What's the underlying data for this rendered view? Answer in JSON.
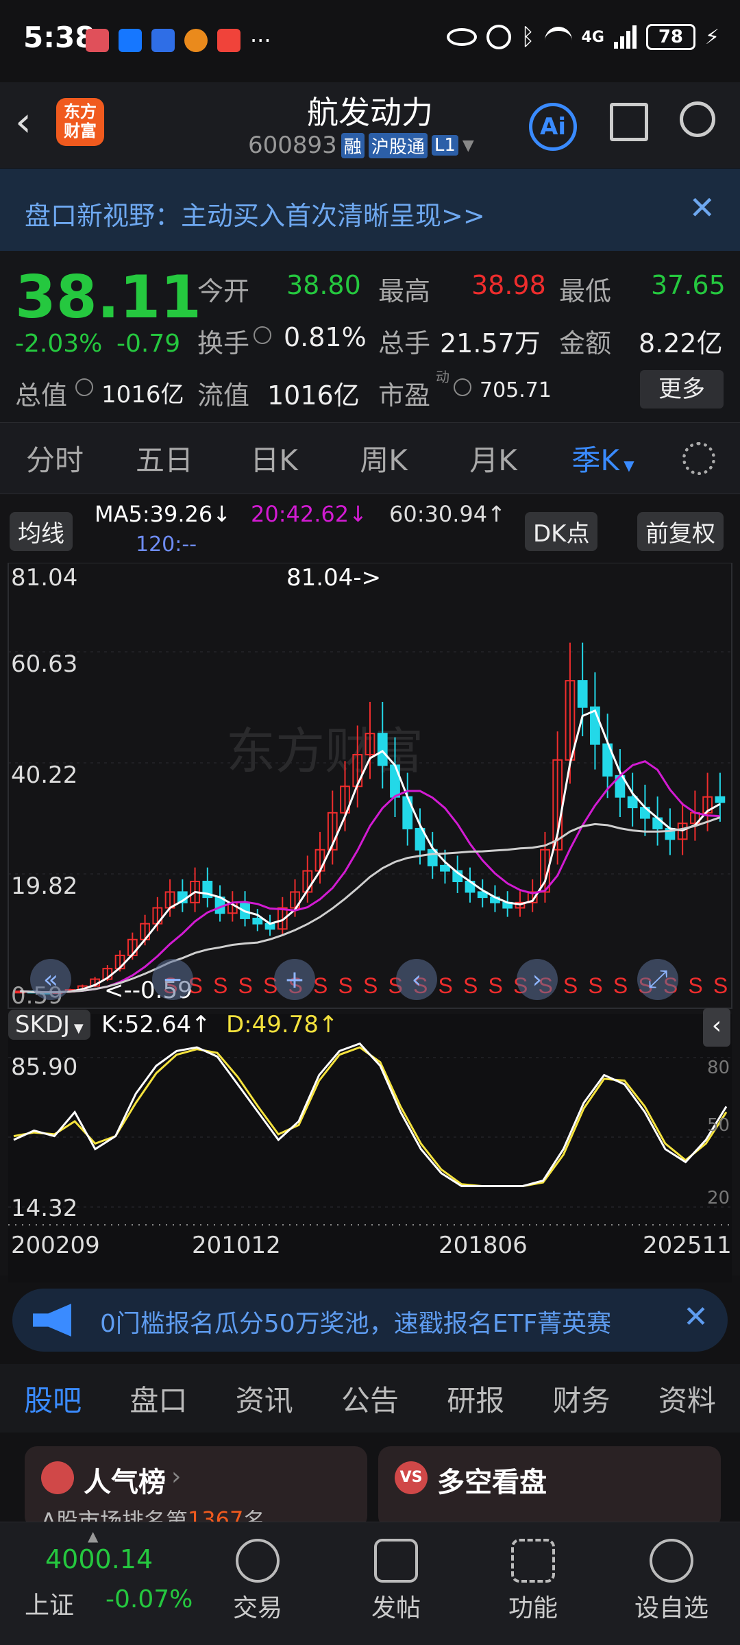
{
  "status": {
    "time": "5:38",
    "ellipsis": "···",
    "signal": "4G",
    "battery": "78"
  },
  "header": {
    "title": "航发动力",
    "code": "600893",
    "tag_rong": "融",
    "tag_hgt": "沪股通",
    "tag_l1": "L1",
    "logo_line1": "东方",
    "logo_line2": "财富",
    "ai_label": "Ai"
  },
  "banner": {
    "text": "盘口新视野：主动买入首次清晰呈现>>",
    "close": "✕"
  },
  "quote": {
    "price": "38.11",
    "change_pct": "-2.03%",
    "change_amt": "-0.79",
    "open_label": "今开",
    "open": "38.80",
    "high_label": "最高",
    "high": "38.98",
    "low_label": "最低",
    "low": "37.65",
    "turnover_label": "换手",
    "turnover": "0.81%",
    "volume_label": "总手",
    "volume": "21.57万",
    "amount_label": "金额",
    "amount": "8.22亿",
    "mcap_label": "总值",
    "mcap": "1016亿",
    "float_label": "流值",
    "float": "1016亿",
    "pe_label": "市盈",
    "pe_sup": "动",
    "pe": "705.71",
    "more": "更多"
  },
  "ktabs": [
    "分时",
    "五日",
    "日K",
    "周K",
    "月K",
    "季K"
  ],
  "chart_header": {
    "ma_btn": "均线",
    "ma5": "MA5:39.26↓",
    "ma20": "20:42.62↓",
    "ma60": "60:30.94↑",
    "ma120": "120:--",
    "dk_btn": "DK点",
    "fq_btn": "前复权"
  },
  "chart_data": {
    "type": "candlestick",
    "y_ticks": [
      "81.04",
      "60.63",
      "40.22",
      "19.82",
      "0.59"
    ],
    "ylim": [
      0.59,
      81.04
    ],
    "high_note": "81.04->",
    "low_note": "<--0.59",
    "x_ticks": [
      "200209",
      "201012",
      "201806",
      "202511"
    ],
    "signal": "S",
    "closes": [
      1.2,
      1.0,
      0.9,
      1.1,
      1.5,
      2.2,
      3.5,
      5.5,
      8,
      11,
      14,
      17,
      20,
      18,
      22,
      19,
      16,
      18,
      15,
      14,
      13,
      17,
      20,
      24,
      28,
      35,
      40,
      46,
      50,
      44,
      38,
      32,
      28,
      25,
      24,
      22,
      20,
      19,
      18,
      17,
      18,
      20,
      28,
      45,
      60,
      55,
      48,
      42,
      38,
      36,
      34,
      32,
      30,
      33,
      35,
      38,
      37
    ],
    "colors": {
      "ma5": "#ffffff",
      "ma20": "#d21bd2",
      "ma60": "#cfcfcf",
      "up": "#ef2d2d",
      "down": "#23d8e8",
      "k": "#ffffff",
      "d": "#f4e23d"
    }
  },
  "indicator": {
    "name": "SKDJ",
    "k": "K:52.64↑",
    "d": "D:49.78↑",
    "y_top": "85.90",
    "y_bottom": "14.32",
    "r80": "80",
    "r50": "50",
    "r20": "20",
    "k_values": [
      40,
      45,
      42,
      55,
      35,
      42,
      65,
      80,
      88,
      90,
      85,
      70,
      55,
      40,
      50,
      75,
      88,
      92,
      80,
      55,
      35,
      22,
      15,
      15,
      15,
      15,
      18,
      35,
      60,
      75,
      70,
      55,
      35,
      28,
      40,
      58
    ],
    "d_values": [
      42,
      44,
      43,
      50,
      38,
      42,
      60,
      76,
      86,
      89,
      87,
      74,
      58,
      43,
      48,
      72,
      86,
      90,
      82,
      58,
      38,
      24,
      16,
      15,
      15,
      15,
      17,
      32,
      57,
      73,
      72,
      58,
      38,
      29,
      38,
      55
    ]
  },
  "promo": {
    "text": "0门槛报名瓜分50万奖池，速戳报名ETF菁英赛",
    "close": "✕"
  },
  "subtabs": [
    "股吧",
    "盘口",
    "资讯",
    "公告",
    "研报",
    "财务",
    "资料"
  ],
  "cards": {
    "left_title": "人气榜",
    "left_sub": "A股市场排名第",
    "left_rank": "1367",
    "left_unit": "名",
    "right_title": "多空看盘",
    "right_icon": "VS"
  },
  "bottom": {
    "index_value": "4000.14",
    "index_name": "上证",
    "index_change": "-0.07%",
    "items": [
      "交易",
      "发帖",
      "功能",
      "设自选"
    ]
  }
}
